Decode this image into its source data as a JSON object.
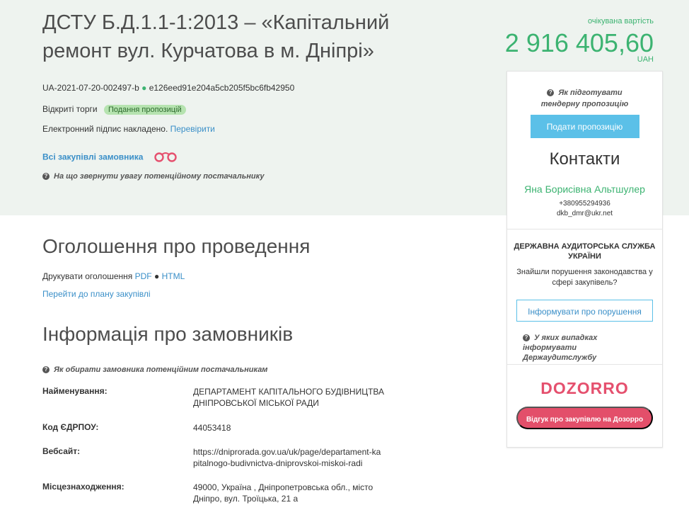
{
  "tender": {
    "title": "ДСТУ Б.Д.1.1-1:2013 – «Капітальний ремонт вул. Курчатова в м. Дніпрі»",
    "id": "UA-2021-07-20-002497-b",
    "hash": "e126eed91e204a5cb205f5bc6fb42950",
    "procedure": "Відкриті торги",
    "status": "Подання пропозицій",
    "signature_text": "Електронний підпис накладено.",
    "signature_link": "Перевірити",
    "all_purchases": "Всі закупівлі замовника",
    "supplier_note": "На що звернути увагу потенційному постачальнику"
  },
  "price": {
    "label": "очікувана вартість",
    "value": "2 916 405,60",
    "currency": "UAH"
  },
  "sidebar": {
    "howto": "Як підготувати тендерну пропозицію",
    "submit": "Подати пропозицію",
    "contacts_title": "Контакти",
    "contact_name": "Яна Борисівна Альтшулер",
    "phone": "+380955294936",
    "email": "dkb_dmr@ukr.net",
    "audit_title": "ДЕРЖАВНА АУДИТОРСЬКА СЛУЖБА УКРАЇНИ",
    "audit_text": "Знайшли порушення законодавства у сфері закупівель?",
    "report_btn": "Інформувати про порушення",
    "audit_note": "У яких випадках інформувати Держаудитслужбу",
    "logo": "DOZORRO",
    "review_btn": "Відгук про закупівлю на Дозорро"
  },
  "announcement": {
    "heading": "Оголошення про проведення",
    "print_label": "Друкувати оголошення",
    "pdf": "PDF",
    "html": "HTML",
    "plan_link": "Перейти до плану закупівлі"
  },
  "customer": {
    "heading": "Інформація про замовників",
    "note": "Як обирати замовника потенційним постачальникам",
    "rows": [
      {
        "label": "Найменування:",
        "value": "ДЕПАРТАМЕНТ КАПІТАЛЬНОГО БУДІВНИЦТВА ДНІПРОВСЬКОЇ МІСЬКОЇ РАДИ"
      },
      {
        "label": "Код ЄДРПОУ:",
        "value": "44053418"
      },
      {
        "label": "Вебсайт:",
        "value": "https://dniprorada.gov.ua/uk/page/departament-kapitalnogo-budivnictva-dniprovskoi-miskoi-radi"
      },
      {
        "label": "Місцезнаходження:",
        "value": "49000, Україна , Дніпропетровська обл., місто Дніпро, вул. Троїцька, 21 а"
      }
    ]
  },
  "colors": {
    "accent_green": "#3cb371",
    "link_blue": "#3a8fc8",
    "button_blue": "#5bc0e8",
    "dozorro_pink": "#e34f6a",
    "hero_bg": "#eef3ef"
  }
}
